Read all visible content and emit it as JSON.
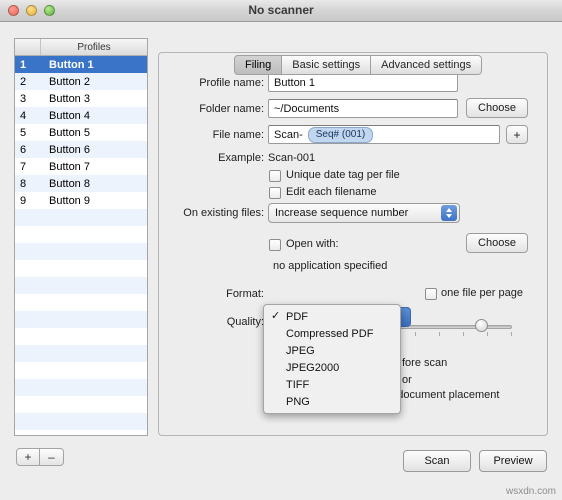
{
  "window": {
    "title": "No scanner"
  },
  "profiles": {
    "header_num": "",
    "header_name": "Profiles",
    "rows": [
      {
        "num": "1",
        "name": "Button 1",
        "selected": true
      },
      {
        "num": "2",
        "name": "Button 2",
        "selected": false
      },
      {
        "num": "3",
        "name": "Button 3",
        "selected": false
      },
      {
        "num": "4",
        "name": "Button 4",
        "selected": false
      },
      {
        "num": "5",
        "name": "Button 5",
        "selected": false
      },
      {
        "num": "6",
        "name": "Button 6",
        "selected": false
      },
      {
        "num": "7",
        "name": "Button 7",
        "selected": false
      },
      {
        "num": "8",
        "name": "Button 8",
        "selected": false
      },
      {
        "num": "9",
        "name": "Button 9",
        "selected": false
      }
    ],
    "add_label": "+",
    "remove_label": "–"
  },
  "tabs": [
    {
      "label": "Filing",
      "active": true
    },
    {
      "label": "Basic settings",
      "active": false
    },
    {
      "label": "Advanced settings",
      "active": false
    }
  ],
  "filing": {
    "profile_name_label": "Profile name:",
    "profile_name_value": "Button 1",
    "folder_name_label": "Folder name:",
    "folder_name_value": "~/Documents",
    "folder_choose_label": "Choose",
    "file_name_label": "File name:",
    "file_name_value": "Scan-",
    "file_name_token": "Seq# (001)",
    "file_name_add_label": "+",
    "example_label": "Example:",
    "example_value": "Scan-001",
    "unique_date_tag_label": "Unique date tag per file",
    "unique_date_tag_checked": false,
    "edit_each_filename_label": "Edit each filename",
    "edit_each_filename_checked": false,
    "on_existing_files_label": "On existing files:",
    "on_existing_files_value": "Increase sequence number",
    "open_with_label": "Open with:",
    "open_with_checked": false,
    "open_with_choose_label": "Choose",
    "no_application_text": "no application specified",
    "format_label": "Format:",
    "format_value": "PDF",
    "one_file_per_page_label": "one file per page",
    "one_file_per_page_checked": false,
    "quality_label": "Quality:",
    "hidden_option_1": "fore scan",
    "hidden_option_2": "or",
    "open_scan_window_label": "Open scan window on document placement",
    "open_scan_window_checked": false
  },
  "format_menu": {
    "items": [
      {
        "label": "PDF",
        "checked": true
      },
      {
        "label": "Compressed PDF",
        "checked": false
      },
      {
        "label": "JPEG",
        "checked": false
      },
      {
        "label": "JPEG2000",
        "checked": false
      },
      {
        "label": "TIFF",
        "checked": false
      },
      {
        "label": "PNG",
        "checked": false
      }
    ]
  },
  "footer": {
    "scan_label": "Scan",
    "preview_label": "Preview"
  },
  "watermark": "wsxdn.com"
}
